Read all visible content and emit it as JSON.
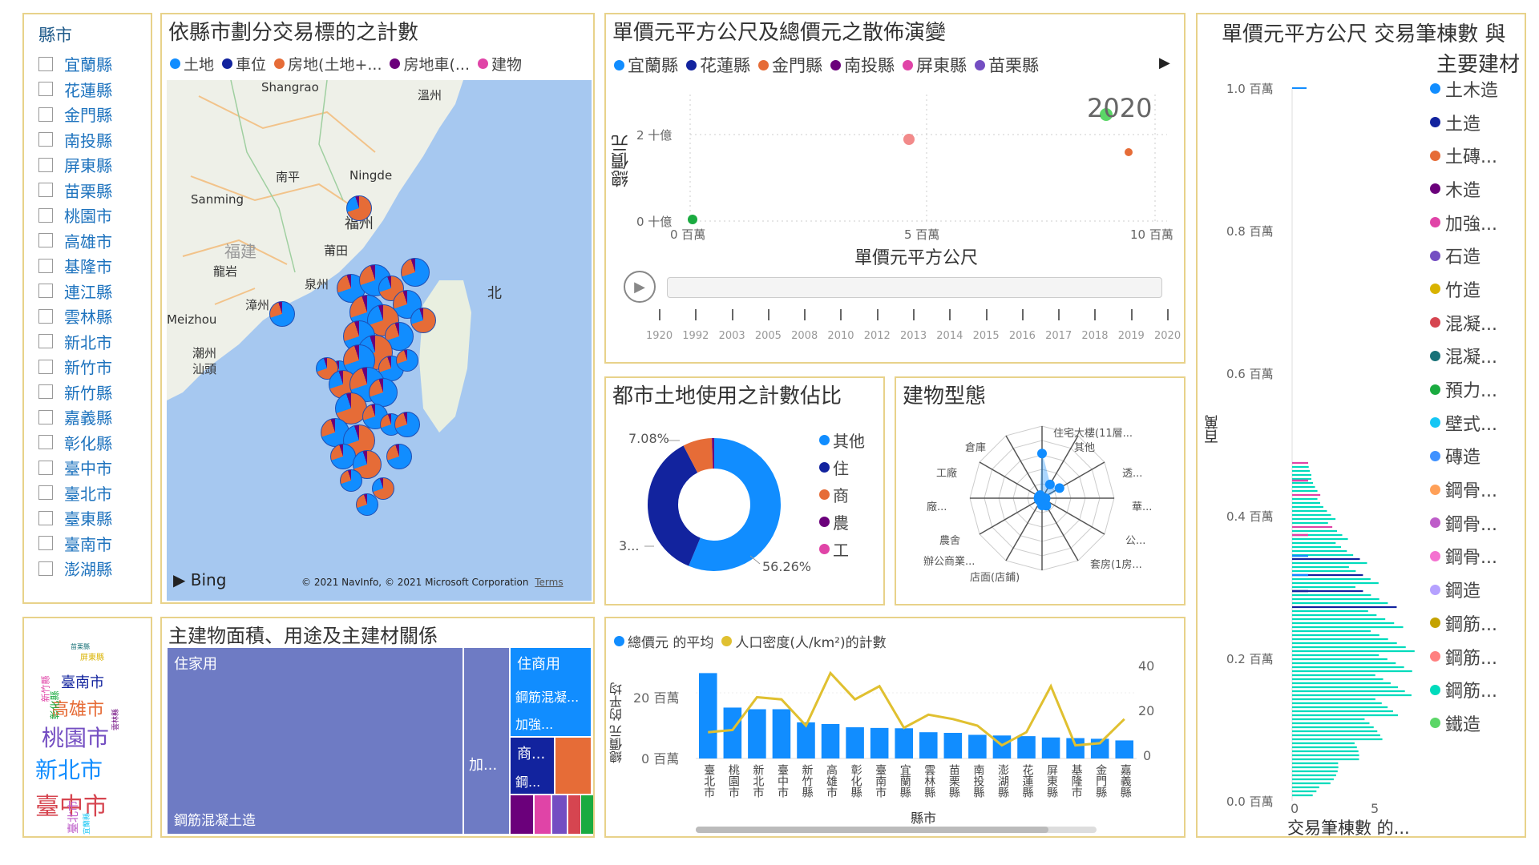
{
  "slicer": {
    "title": "縣市",
    "items": [
      "宜蘭縣",
      "花蓮縣",
      "金門縣",
      "南投縣",
      "屏東縣",
      "苗栗縣",
      "桃園市",
      "高雄市",
      "基隆市",
      "連江縣",
      "雲林縣",
      "新北市",
      "新竹市",
      "新竹縣",
      "嘉義縣",
      "彰化縣",
      "臺中市",
      "臺北市",
      "臺東縣",
      "臺南市",
      "澎湖縣"
    ]
  },
  "map_panel": {
    "title": "依縣市劃分交易標的之計數",
    "legend": [
      {
        "label": "土地",
        "color": "#118dff"
      },
      {
        "label": "車位",
        "color": "#12239e"
      },
      {
        "label": "房地(土地+...",
        "color": "#e66c37"
      },
      {
        "label": "房地車(...",
        "color": "#6b007b"
      },
      {
        "label": "建物",
        "color": "#e044a7"
      }
    ],
    "cities": [
      "Shangrao",
      "溫州",
      "南平",
      "Ningde",
      "Sanming",
      "福州",
      "福建",
      "莆田",
      "龍岩",
      "泉州",
      "漳州",
      "Meizhou",
      "潮州",
      "汕頭",
      "北"
    ],
    "bing_logo": "Bing",
    "copyright": "© 2021 NavInfo, © 2021 Microsoft Corporation",
    "terms": "Terms"
  },
  "scatter_panel": {
    "title": "單價元平方公尺及總價元之散佈演變",
    "legend": [
      {
        "label": "宜蘭縣",
        "color": "#118dff"
      },
      {
        "label": "花蓮縣",
        "color": "#12239e"
      },
      {
        "label": "金門縣",
        "color": "#e66c37"
      },
      {
        "label": "南投縣",
        "color": "#6b007b"
      },
      {
        "label": "屏東縣",
        "color": "#e044a7"
      },
      {
        "label": "苗栗縣",
        "color": "#744ec2"
      }
    ],
    "year_label": "2020",
    "ylabel": "總價元",
    "xlabel": "單價元平方公尺",
    "yticks": [
      "0 十億",
      "2 十億"
    ],
    "xticks": [
      "0 百萬",
      "5 百萬",
      "10 百萬"
    ],
    "play_years": [
      "1920",
      "1992",
      "2003",
      "2005",
      "2008",
      "2010",
      "2012",
      "2013",
      "2014",
      "2015",
      "2016",
      "2017",
      "2018",
      "2019",
      "2020"
    ]
  },
  "donut_panel": {
    "title": "都市土地使用之計數佔比",
    "labels": {
      "a": "7.08%",
      "b": "3...",
      "c": "56.26%"
    },
    "legend": [
      {
        "label": "其他",
        "color": "#118dff"
      },
      {
        "label": "住",
        "color": "#12239e"
      },
      {
        "label": "商",
        "color": "#e66c37"
      },
      {
        "label": "農",
        "color": "#6b007b"
      },
      {
        "label": "工",
        "color": "#e044a7"
      }
    ]
  },
  "radar_panel": {
    "title": "建物型態",
    "axes": [
      "住宅大樓(11層...",
      "其他",
      "透...",
      "華...",
      "公...",
      "套房(1房...",
      "店面(店鋪)",
      "辦公商業...",
      "農舍",
      "廠...",
      "工廠",
      "倉庫"
    ]
  },
  "treemap_panel": {
    "title": "主建物面積、用途及主建材關係",
    "cells": {
      "main": "住家用",
      "main_sub": "鋼筋混凝土造",
      "side1": "加...",
      "res_com": "住商用",
      "rc": "鋼筋混凝...",
      "add": "加強...",
      "biz": "商...",
      "steel": "鋼..."
    }
  },
  "combo_panel": {
    "legend": [
      {
        "label": "總價元 的平均",
        "color": "#118dff"
      },
      {
        "label": "人口密度(人/km²)的計數",
        "color": "#e0c030"
      }
    ],
    "ylabel": "總價元 的平均",
    "xlabel": "縣市",
    "yticks_left": [
      "0 百萬",
      "20 百萬"
    ],
    "yticks_right": [
      "0",
      "20",
      "40"
    ],
    "chart_data": {
      "type": "bar",
      "categories": [
        "臺北市",
        "桃園市",
        "新北市",
        "臺中市",
        "新竹縣",
        "高雄市",
        "彰化縣",
        "臺南市",
        "宜蘭縣",
        "雲林縣",
        "苗栗縣",
        "南投縣",
        "澎湖縣",
        "花蓮縣",
        "屏東縣",
        "基隆市",
        "金門縣",
        "嘉義縣"
      ],
      "series": [
        {
          "name": "總價元 的平均",
          "type": "bar",
          "values": [
            26,
            15.5,
            15,
            15,
            11,
            10.5,
            9.5,
            9.3,
            9.2,
            8,
            7.8,
            7.2,
            7,
            6.8,
            6.4,
            6.2,
            6,
            5.5
          ]
        },
        {
          "name": "人口密度(人/km²)的計數",
          "type": "line",
          "values": [
            12,
            13,
            28,
            27,
            15,
            39,
            27,
            33,
            14,
            20,
            18,
            15,
            6,
            12,
            33,
            6,
            7,
            18
          ]
        }
      ],
      "ylim_left": [
        0,
        30
      ],
      "ylim_right": [
        0,
        45
      ]
    }
  },
  "histo_panel": {
    "title_line1": "單價元平方公尺 交易筆棟數 與",
    "title_line2": "主要建材",
    "ylabel": "百萬",
    "xlabel": "交易筆棟數 的...",
    "yticks": [
      "0.0 百萬",
      "0.2 百萬",
      "0.4 百萬",
      "0.6 百萬",
      "0.8 百萬",
      "1.0 百萬"
    ],
    "xticks": [
      "0",
      "5"
    ],
    "legend": [
      {
        "label": "土木造",
        "color": "#118dff"
      },
      {
        "label": "土造",
        "color": "#12239e"
      },
      {
        "label": "土磚...",
        "color": "#e66c37"
      },
      {
        "label": "木造",
        "color": "#6b007b"
      },
      {
        "label": "加強...",
        "color": "#e044a7"
      },
      {
        "label": "石造",
        "color": "#744ec2"
      },
      {
        "label": "竹造",
        "color": "#d9b300"
      },
      {
        "label": "混凝...",
        "color": "#d64550"
      },
      {
        "label": "混凝...",
        "color": "#197278"
      },
      {
        "label": "預力...",
        "color": "#1aab40"
      },
      {
        "label": "壁式...",
        "color": "#15c6f4"
      },
      {
        "label": "磚造",
        "color": "#4092ff"
      },
      {
        "label": "鋼骨...",
        "color": "#ffa058"
      },
      {
        "label": "鋼骨...",
        "color": "#be5dc9"
      },
      {
        "label": "鋼骨...",
        "color": "#f472d0"
      },
      {
        "label": "鋼造",
        "color": "#b5a1ff"
      },
      {
        "label": "鋼筋...",
        "color": "#c4a200"
      },
      {
        "label": "鋼筋...",
        "color": "#ff8080"
      },
      {
        "label": "鋼筋...",
        "color": "#00dbbc"
      },
      {
        "label": "鐵造",
        "color": "#5bd667"
      }
    ]
  },
  "wordcloud": {
    "words": [
      {
        "t": "臺中市",
        "c": "#d64550",
        "s": 30
      },
      {
        "t": "新北市",
        "c": "#118dff",
        "s": 28
      },
      {
        "t": "桃園市",
        "c": "#744ec2",
        "s": 28
      },
      {
        "t": "高雄市",
        "c": "#e66c37",
        "s": 22
      },
      {
        "t": "臺南市",
        "c": "#12239e",
        "s": 18
      },
      {
        "t": "臺北市",
        "c": "#be5dc9",
        "s": 14
      },
      {
        "t": "彰化縣",
        "c": "#1aab40",
        "s": 12
      },
      {
        "t": "新竹縣",
        "c": "#e044a7",
        "s": 11
      },
      {
        "t": "屏東縣",
        "c": "#d9b300",
        "s": 10
      },
      {
        "t": "宜蘭縣",
        "c": "#15c6f4",
        "s": 9
      },
      {
        "t": "雲林縣",
        "c": "#6b007b",
        "s": 9
      },
      {
        "t": "苗栗縣",
        "c": "#197278",
        "s": 8
      }
    ]
  }
}
